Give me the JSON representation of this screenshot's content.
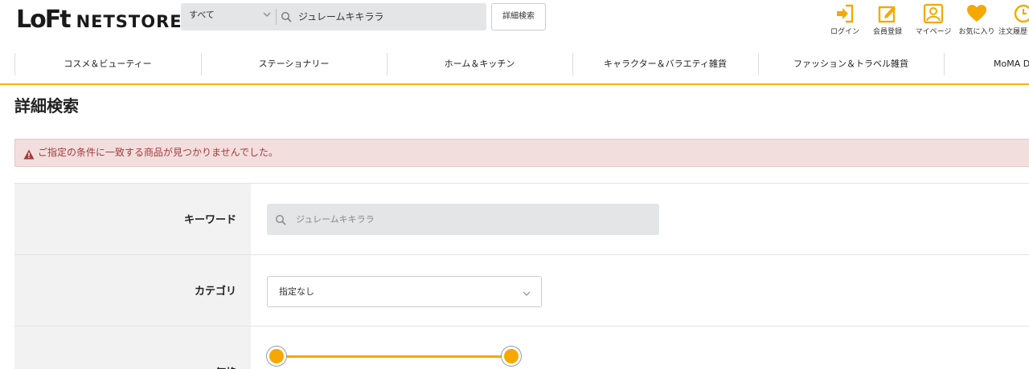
{
  "header": {
    "logo": {
      "mark": "LoFt",
      "suffix": "NETSTORE"
    },
    "search": {
      "category": "すべて",
      "query": "ジュレームキキララ"
    },
    "advanced_search_label": "詳細検索",
    "utilities": [
      {
        "icon": "login-icon",
        "label": "ログイン"
      },
      {
        "icon": "register-icon",
        "label": "会員登録"
      },
      {
        "icon": "mypage-icon",
        "label": "マイページ"
      },
      {
        "icon": "heart-icon",
        "label": "お気に入り"
      },
      {
        "icon": "order-history-icon",
        "label": "注文履歴"
      }
    ],
    "accent_color": "#f5a800"
  },
  "nav": {
    "items": [
      "コスメ＆ビューティー",
      "ステーショナリー",
      "ホーム＆キッチン",
      "キャラクター＆バラエティ雑貨",
      "ファッション＆トラベル雑貨",
      "MoMA Design Store"
    ]
  },
  "page": {
    "title": "詳細検索",
    "alert": "ご指定の条件に一致する商品が見つかりませんでした。",
    "alert_color": "#a43b3b"
  },
  "form": {
    "keyword": {
      "label": "キーワード",
      "value": "ジュレームキキララ"
    },
    "category": {
      "label": "カテゴリ",
      "value": "指定なし"
    },
    "price": {
      "label": "価格"
    }
  }
}
